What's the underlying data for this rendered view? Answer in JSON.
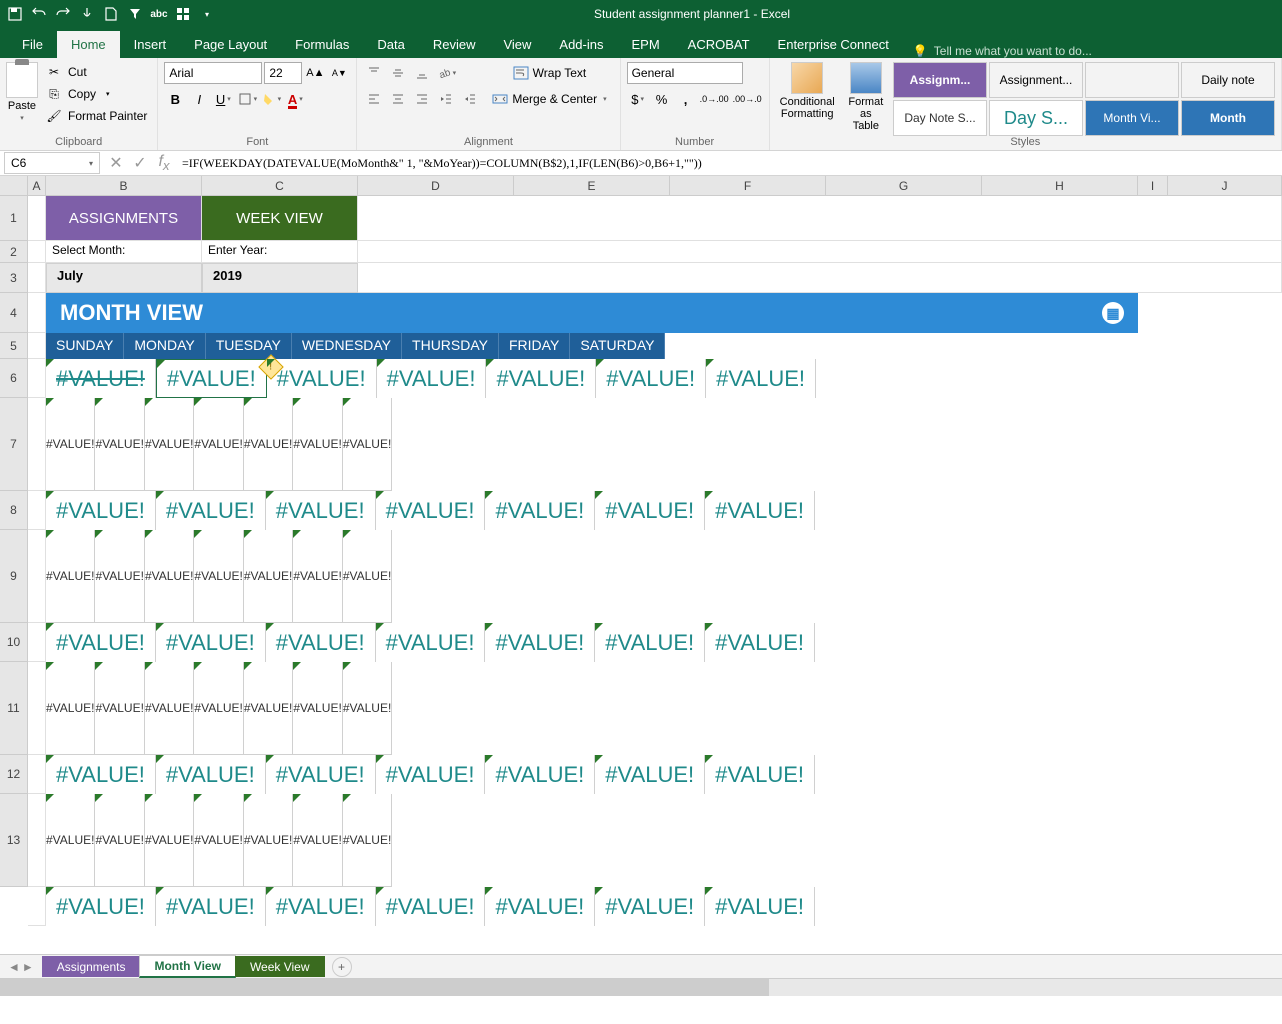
{
  "title": "Student assignment planner1 - Excel",
  "tabs": {
    "file": "File",
    "home": "Home",
    "insert": "Insert",
    "pagelayout": "Page Layout",
    "formulas": "Formulas",
    "data": "Data",
    "review": "Review",
    "view": "View",
    "addins": "Add-ins",
    "epm": "EPM",
    "acrobat": "ACROBAT",
    "enterprise": "Enterprise Connect"
  },
  "tellme": "Tell me what you want to do...",
  "clipboard": {
    "paste": "Paste",
    "cut": "Cut",
    "copy": "Copy",
    "painter": "Format Painter",
    "label": "Clipboard"
  },
  "font": {
    "name": "Arial",
    "size": "22",
    "label": "Font"
  },
  "alignment": {
    "wrap": "Wrap Text",
    "merge": "Merge & Center",
    "label": "Alignment"
  },
  "number": {
    "format": "General",
    "label": "Number"
  },
  "conditional": "Conditional Formatting",
  "formatas": "Format as Table",
  "styles": {
    "label": "Styles",
    "items": [
      "Assignm...",
      "Assignment...",
      "",
      "Daily note",
      "Day Note S...",
      "Day S...",
      "Month Vi...",
      "Month"
    ]
  },
  "namebox": "C6",
  "formula": "=IF(WEEKDAY(DATEVALUE(MoMonth&\" 1, \"&MoYear))=COLUMN(B$2),1,IF(LEN(B6)>0,B6+1,\"\"))",
  "cols": [
    "A",
    "B",
    "C",
    "D",
    "E",
    "F",
    "G",
    "H",
    "I",
    "J"
  ],
  "rows": [
    "1",
    "2",
    "3",
    "4",
    "5",
    "6",
    "7",
    "8",
    "9",
    "10",
    "11",
    "12",
    "13"
  ],
  "buttons": {
    "assignments": "ASSIGNMENTS",
    "weekview": "WEEK VIEW"
  },
  "labels": {
    "selectmonth": "Select Month:",
    "enteryear": "Enter Year:"
  },
  "inputs": {
    "month": "July",
    "year": "2019"
  },
  "banner": "MONTH VIEW",
  "days": [
    "SUNDAY",
    "MONDAY",
    "TUESDAY",
    "WEDNESDAY",
    "THURSDAY",
    "FRIDAY",
    "SATURDAY"
  ],
  "error": "#VALUE!",
  "sheettabs": {
    "assignments": "Assignments",
    "monthview": "Month View",
    "weekview": "Week View"
  }
}
